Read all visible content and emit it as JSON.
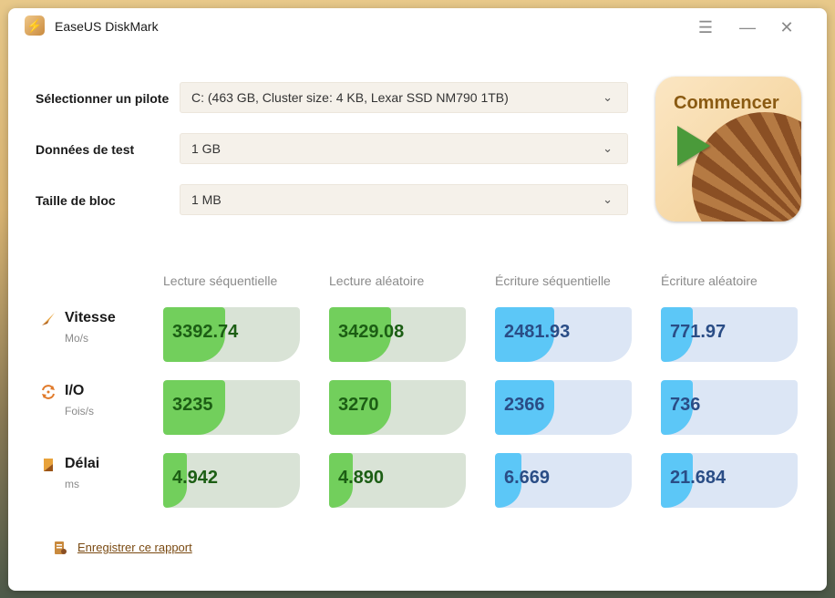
{
  "window": {
    "title": "EaseUS DiskMark"
  },
  "controls": {
    "menu": "☰",
    "minimize": "—",
    "close": "✕"
  },
  "settings": {
    "drive_label": "Sélectionner un pilote",
    "drive_value": "C: (463 GB, Cluster size: 4 KB, Lexar SSD NM790 1TB)",
    "test_data_label": "Données de test",
    "test_data_value": "1 GB",
    "block_size_label": "Taille de bloc",
    "block_size_value": "1 MB"
  },
  "start_button": {
    "label": "Commencer"
  },
  "columns": [
    "Lecture séquentielle",
    "Lecture aléatoire",
    "Écriture séquentielle",
    "Écriture aléatoire"
  ],
  "metrics": [
    {
      "name": "Vitesse",
      "unit": "Mo/s",
      "values": [
        "3392.74",
        "3429.08",
        "2481.93",
        "771.97"
      ],
      "fill": [
        0.45,
        0.45,
        0.43,
        0.23
      ]
    },
    {
      "name": "I/O",
      "unit": "Fois/s",
      "values": [
        "3235",
        "3270",
        "2366",
        "736"
      ],
      "fill": [
        0.45,
        0.45,
        0.43,
        0.23
      ]
    },
    {
      "name": "Délai",
      "unit": "ms",
      "values": [
        "4.942",
        "4.890",
        "6.669",
        "21.684"
      ],
      "fill": [
        0.17,
        0.17,
        0.19,
        0.23
      ]
    }
  ],
  "colors": {
    "read": "#72cf5c",
    "write": "#5cc7f7",
    "accent": "#8a5a12"
  },
  "footer": {
    "save_report": "Enregistrer ce rapport"
  }
}
